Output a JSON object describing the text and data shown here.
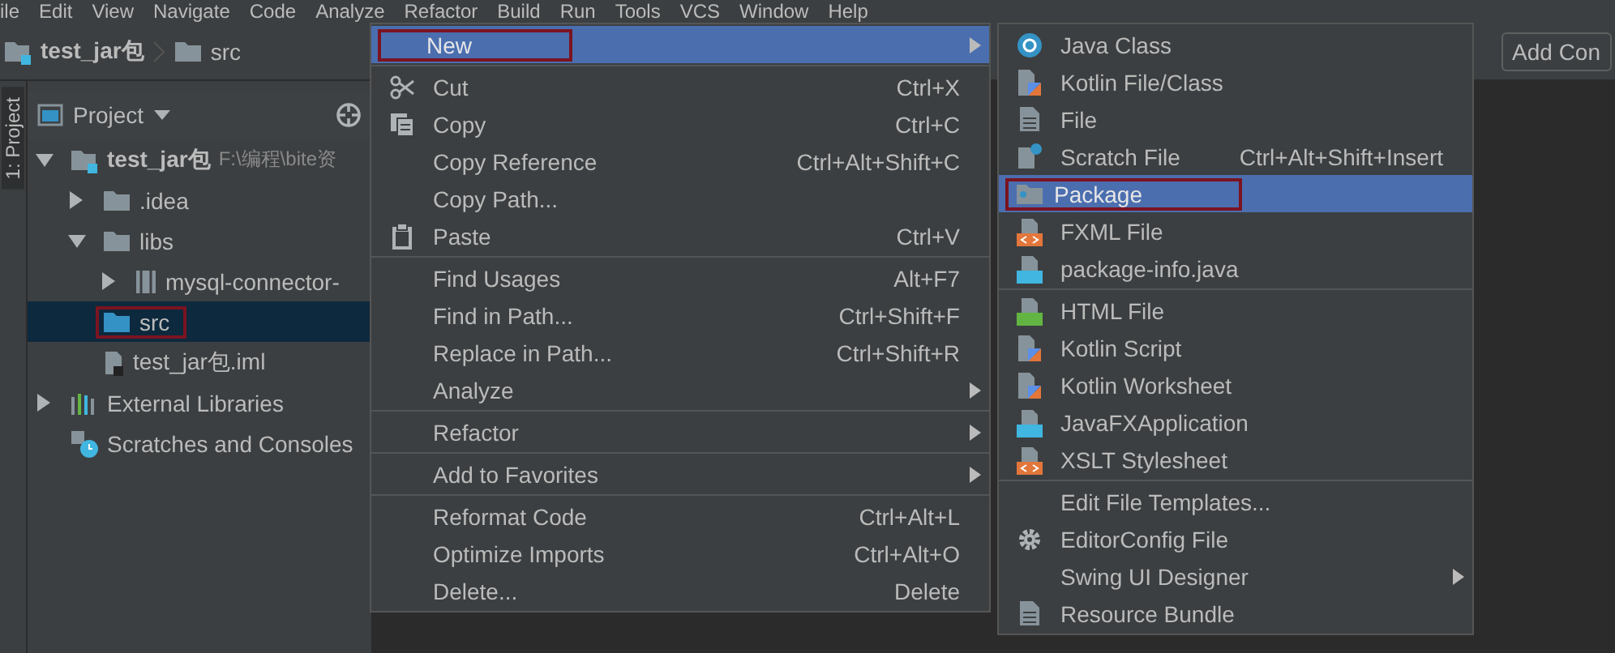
{
  "menu_bar": [
    "ile",
    "Edit",
    "View",
    "Navigate",
    "Code",
    "Analyze",
    "Refactor",
    "Build",
    "Run",
    "Tools",
    "VCS",
    "Window",
    "Help"
  ],
  "breadcrumb": [
    {
      "label": "test_jar包",
      "kind": "module"
    },
    {
      "label": "src",
      "kind": "folder"
    }
  ],
  "run_config_button": "Add Con",
  "tool_strip": "1: Project",
  "project_panel": {
    "title": "Project",
    "tree": [
      {
        "label": "test_jar包",
        "kind": "module",
        "note": "F:\\编程\\bite资",
        "expanded": true,
        "selected": false,
        "outlined": false,
        "children": [
          {
            "label": ".idea",
            "kind": "folder",
            "expanded": false,
            "selected": false,
            "outlined": false
          },
          {
            "label": "libs",
            "kind": "folder",
            "expanded": true,
            "selected": false,
            "outlined": false,
            "children": [
              {
                "label": "mysql-connector-",
                "kind": "jar",
                "expanded": false,
                "selected": false,
                "outlined": false
              }
            ]
          },
          {
            "label": "src",
            "kind": "source",
            "selected": true,
            "outlined": true
          },
          {
            "label": "test_jar包.iml",
            "kind": "iml",
            "selected": false,
            "outlined": false
          }
        ]
      },
      {
        "label": "External Libraries",
        "kind": "libraries",
        "expanded": false,
        "selected": false,
        "outlined": false
      },
      {
        "label": "Scratches and Consoles",
        "kind": "scratches",
        "selected": false,
        "outlined": false
      }
    ]
  },
  "context_menu": {
    "items": [
      {
        "label": "New",
        "kind": "submenu",
        "selected": true,
        "outlined": true
      },
      {
        "kind": "separator"
      },
      {
        "label": "Cut",
        "kind": "cut",
        "shortcut": "Ctrl+X",
        "selected": false,
        "outlined": false
      },
      {
        "label": "Copy",
        "kind": "copy",
        "shortcut": "Ctrl+C",
        "selected": false,
        "outlined": false
      },
      {
        "label": "Copy Reference",
        "kind": "plain",
        "shortcut": "Ctrl+Alt+Shift+C",
        "selected": false,
        "outlined": false
      },
      {
        "label": "Copy Path...",
        "kind": "plain",
        "selected": false,
        "outlined": false
      },
      {
        "label": "Paste",
        "kind": "paste",
        "shortcut": "Ctrl+V",
        "selected": false,
        "outlined": false
      },
      {
        "kind": "separator"
      },
      {
        "label": "Find Usages",
        "kind": "plain",
        "shortcut": "Alt+F7",
        "selected": false,
        "outlined": false
      },
      {
        "label": "Find in Path...",
        "kind": "plain",
        "shortcut": "Ctrl+Shift+F",
        "selected": false,
        "outlined": false
      },
      {
        "label": "Replace in Path...",
        "kind": "plain",
        "shortcut": "Ctrl+Shift+R",
        "selected": false,
        "outlined": false
      },
      {
        "label": "Analyze",
        "kind": "submenu",
        "selected": false,
        "outlined": false
      },
      {
        "kind": "separator"
      },
      {
        "label": "Refactor",
        "kind": "submenu",
        "selected": false,
        "outlined": false
      },
      {
        "kind": "separator"
      },
      {
        "label": "Add to Favorites",
        "kind": "submenu",
        "selected": false,
        "outlined": false
      },
      {
        "kind": "separator"
      },
      {
        "label": "Reformat Code",
        "kind": "plain",
        "shortcut": "Ctrl+Alt+L",
        "selected": false,
        "outlined": false
      },
      {
        "label": "Optimize Imports",
        "kind": "plain",
        "shortcut": "Ctrl+Alt+O",
        "selected": false,
        "outlined": false
      },
      {
        "label": "Delete...",
        "kind": "plain",
        "shortcut": "Delete",
        "selected": false,
        "outlined": false
      }
    ]
  },
  "new_submenu": {
    "items": [
      {
        "label": "Java Class",
        "kind": "class",
        "selected": false,
        "outlined": false
      },
      {
        "label": "Kotlin File/Class",
        "kind": "kotlin",
        "selected": false,
        "outlined": false
      },
      {
        "label": "File",
        "kind": "file",
        "selected": false,
        "outlined": false
      },
      {
        "label": "Scratch File",
        "kind": "scratch",
        "shortcut": "Ctrl+Alt+Shift+Insert",
        "selected": false,
        "outlined": false
      },
      {
        "label": "Package",
        "kind": "package",
        "selected": true,
        "outlined": true
      },
      {
        "label": "FXML File",
        "kind": "markup",
        "selected": false,
        "outlined": false
      },
      {
        "label": "package-info.java",
        "kind": "javafile",
        "selected": false,
        "outlined": false
      },
      {
        "kind": "separator"
      },
      {
        "label": "HTML File",
        "kind": "html",
        "selected": false,
        "outlined": false
      },
      {
        "label": "Kotlin Script",
        "kind": "kotlin",
        "selected": false,
        "outlined": false
      },
      {
        "label": "Kotlin Worksheet",
        "kind": "kotlin",
        "selected": false,
        "outlined": false
      },
      {
        "label": "JavaFXApplication",
        "kind": "javafile",
        "selected": false,
        "outlined": false
      },
      {
        "label": "XSLT Stylesheet",
        "kind": "markup",
        "selected": false,
        "outlined": false
      },
      {
        "kind": "separator"
      },
      {
        "label": "Edit File Templates...",
        "kind": "plain",
        "selected": false,
        "outlined": false
      },
      {
        "label": "EditorConfig File",
        "kind": "gear",
        "selected": false,
        "outlined": false
      },
      {
        "label": "Swing UI Designer",
        "kind": "submenu",
        "selected": false,
        "outlined": false
      },
      {
        "label": "Resource Bundle",
        "kind": "file",
        "selected": false,
        "outlined": false
      }
    ]
  }
}
